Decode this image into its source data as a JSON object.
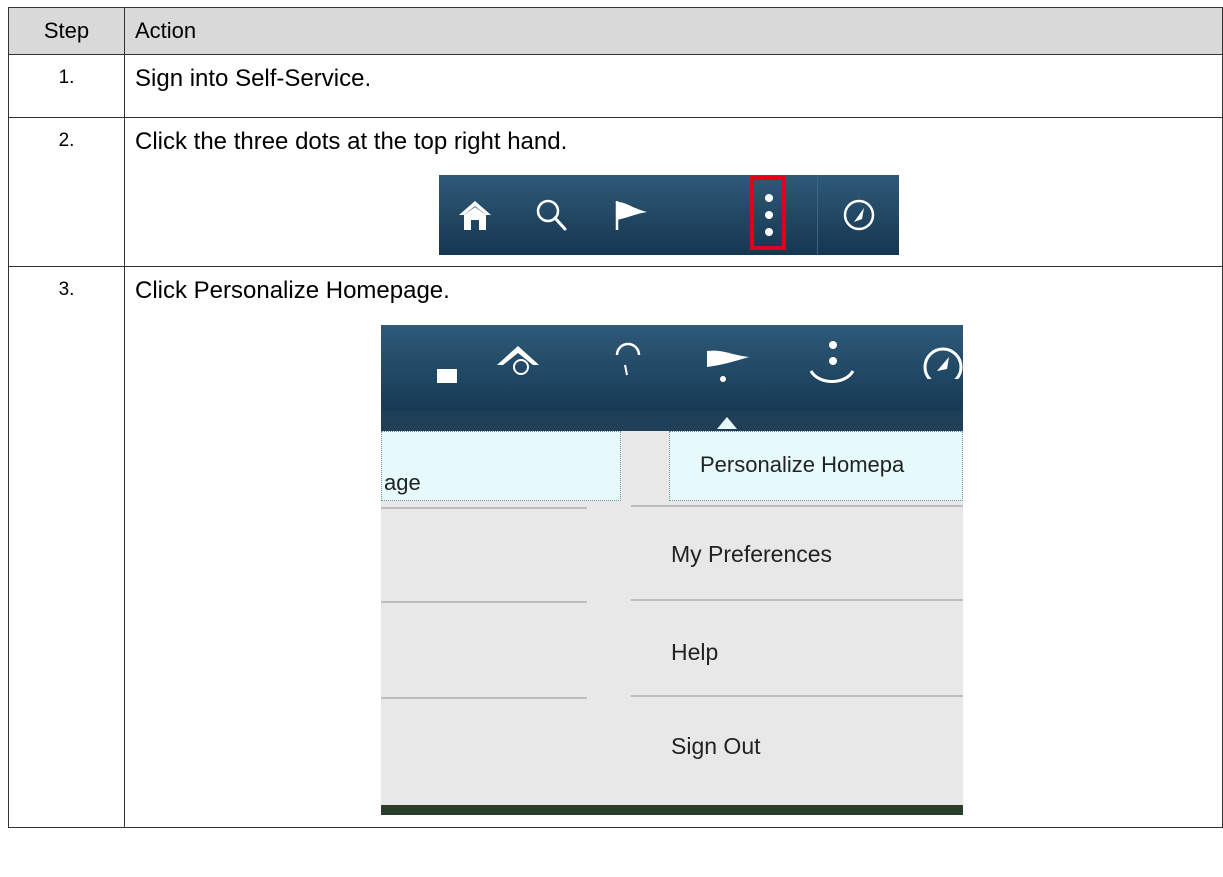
{
  "table": {
    "header": {
      "step": "Step",
      "action": "Action"
    },
    "rows": [
      {
        "step": "1.",
        "action": "Sign into Self-Service."
      },
      {
        "step": "2.",
        "action": "Click the three dots at the top right hand."
      },
      {
        "step": "3.",
        "action": "Click Personalize Homepage."
      }
    ]
  },
  "toolbar": {
    "icons": [
      "home-icon",
      "search-icon",
      "flag-icon",
      "more-actions-icon",
      "navigator-icon"
    ],
    "highlight_color": "#e3001b",
    "bar_color": "#1f4662"
  },
  "menu": {
    "tile_left_text": "age",
    "tile_right_text": "Personalize Homepa",
    "items": [
      "My Preferences",
      "Help",
      "Sign Out"
    ],
    "tile_color": "#e7fafb",
    "menu_bg": "#e8e8e8"
  }
}
